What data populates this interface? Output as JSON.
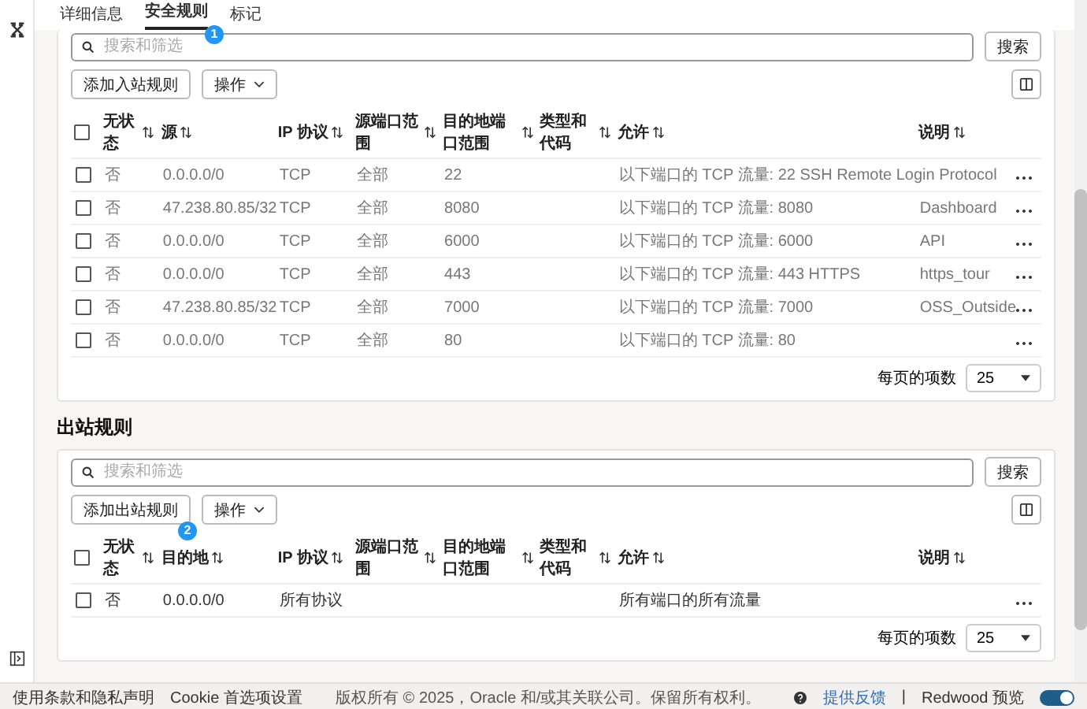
{
  "tabs": [
    {
      "label": "详细信息",
      "selected": false
    },
    {
      "label": "安全规则",
      "selected": true,
      "badge": "1"
    },
    {
      "label": "标记",
      "selected": false
    }
  ],
  "ingress": {
    "search": {
      "placeholder": "搜索和筛选",
      "button": "搜索"
    },
    "add_button": {
      "label": "添加入站规则"
    },
    "actions_button": "操作",
    "select_all_checked": false,
    "columns": [
      "无状态",
      "源",
      "IP 协议",
      "源端口范围",
      "目的地端口范围",
      "类型和代码",
      "允许",
      "说明"
    ],
    "rows": [
      {
        "checked": false,
        "cells": [
          "否",
          "0.0.0.0/0",
          "TCP",
          "全部",
          "22",
          "",
          "以下端口的 TCP 流量: 22 SSH Remote Login Protocol",
          ""
        ]
      },
      {
        "checked": false,
        "cells": [
          "否",
          "47.238.80.85/32",
          "TCP",
          "全部",
          "8080",
          "",
          "以下端口的 TCP 流量: 8080",
          "Dashboard"
        ]
      },
      {
        "checked": false,
        "cells": [
          "否",
          "0.0.0.0/0",
          "TCP",
          "全部",
          "6000",
          "",
          "以下端口的 TCP 流量: 6000",
          "API"
        ]
      },
      {
        "checked": false,
        "cells": [
          "否",
          "0.0.0.0/0",
          "TCP",
          "全部",
          "443",
          "",
          "以下端口的 TCP 流量: 443 HTTPS",
          "https_tour"
        ]
      },
      {
        "checked": false,
        "cells": [
          "否",
          "47.238.80.85/32",
          "TCP",
          "全部",
          "7000",
          "",
          "以下端口的 TCP 流量: 7000",
          "OSS_Outside"
        ]
      },
      {
        "checked": false,
        "cells": [
          "否",
          "0.0.0.0/0",
          "TCP",
          "全部",
          "80",
          "",
          "以下端口的 TCP 流量: 80",
          ""
        ]
      }
    ],
    "per_page_label": "每页的项数",
    "per_page": "25"
  },
  "egress": {
    "heading": "出站规则",
    "search": {
      "placeholder": "搜索和筛选",
      "button": "搜索"
    },
    "add_button": {
      "label": "添加出站规则",
      "badge": "2"
    },
    "actions_button": "操作",
    "select_all_checked": false,
    "columns": [
      "无状态",
      "目的地",
      "IP 协议",
      "源端口范围",
      "目的地端口范围",
      "类型和代码",
      "允许",
      "说明"
    ],
    "rows": [
      {
        "checked": false,
        "cells": [
          "否",
          "0.0.0.0/0",
          "所有协议",
          "",
          "",
          "",
          "所有端口的所有流量",
          ""
        ]
      }
    ],
    "per_page_label": "每页的项数",
    "per_page": "25"
  },
  "footer": {
    "terms_link": "使用条款和隐私声明",
    "cookie_link": "Cookie 首选项设置",
    "copyright": "版权所有 © 2025，Oracle 和/或其关联公司。保留所有权利。",
    "feedback_link": "提供反馈",
    "separator": "|",
    "preview_label": "Redwood 预览",
    "preview_on": true
  }
}
